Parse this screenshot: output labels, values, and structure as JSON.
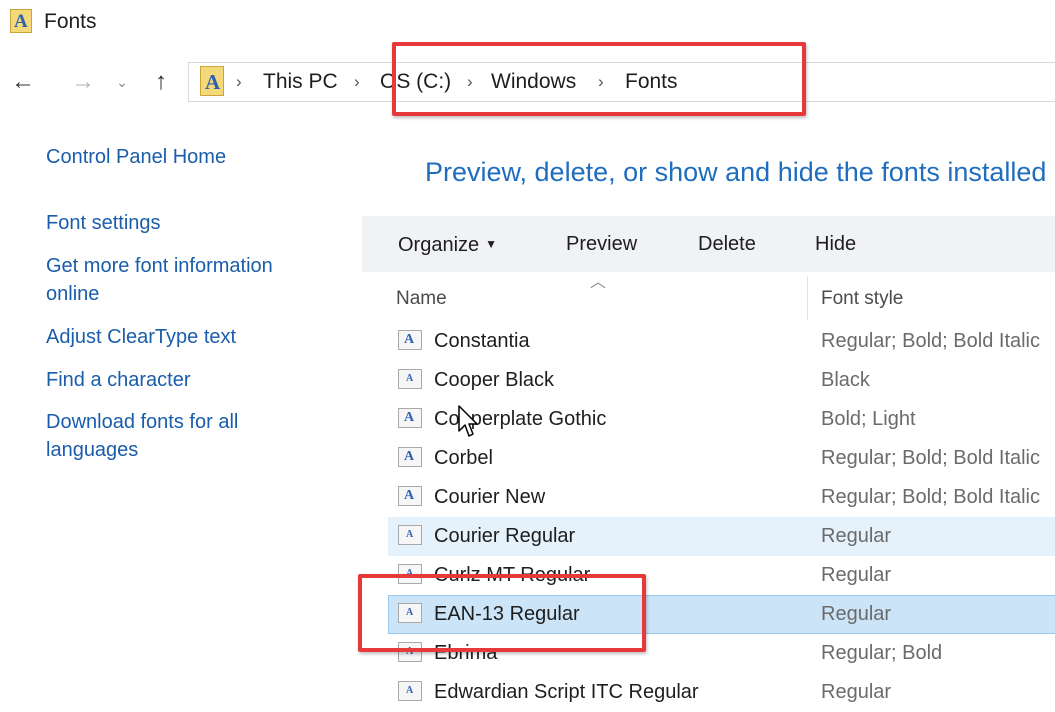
{
  "window": {
    "icon": "fonts-folder-icon",
    "title": "Fonts"
  },
  "nav": {
    "back": "←",
    "forward": "→",
    "recent": "⌄",
    "up": "↑"
  },
  "address": {
    "icon": "fonts-folder-icon",
    "separator": "›",
    "crumbs": [
      "This PC",
      "OS (C:)",
      "Windows",
      "Fonts"
    ]
  },
  "sidebar": {
    "items": [
      {
        "label": "Control Panel Home"
      },
      {
        "label": "Font settings"
      },
      {
        "label": "Get more font information online"
      },
      {
        "label": "Adjust ClearType text"
      },
      {
        "label": "Find a character"
      },
      {
        "label": "Download fonts for all languages"
      }
    ]
  },
  "main": {
    "heading": "Preview, delete, or show and hide the fonts installed",
    "toolbar": {
      "organize": "Organize",
      "preview": "Preview",
      "delete": "Delete",
      "hide": "Hide"
    },
    "columns": {
      "name": "Name",
      "style": "Font style"
    },
    "fonts": [
      {
        "name": "Constantia",
        "style": "Regular; Bold; Bold Italic",
        "icon": "font-icon"
      },
      {
        "name": "Cooper Black",
        "style": "Black",
        "icon": "font-icon"
      },
      {
        "name": "Copperplate Gothic",
        "style": "Bold; Light",
        "icon": "font-icon"
      },
      {
        "name": "Corbel",
        "style": "Regular; Bold; Bold Italic",
        "icon": "font-icon"
      },
      {
        "name": "Courier New",
        "style": "Regular; Bold; Bold Italic",
        "icon": "font-icon"
      },
      {
        "name": "Courier Regular",
        "style": "Regular",
        "icon": "font-icon"
      },
      {
        "name": "Curlz MT Regular",
        "style": "Regular",
        "icon": "font-icon"
      },
      {
        "name": "EAN-13 Regular",
        "style": "Regular",
        "icon": "font-icon"
      },
      {
        "name": "Ebrima",
        "style": "Regular; Bold",
        "icon": "font-icon"
      },
      {
        "name": "Edwardian Script ITC Regular",
        "style": "Regular",
        "icon": "font-icon"
      }
    ]
  },
  "colors": {
    "link": "#1a5dab",
    "heading": "#1f6dbd",
    "annotation": "#e8393a",
    "selected_row": "#cce4f7",
    "hover_row": "#e5f1fb"
  }
}
